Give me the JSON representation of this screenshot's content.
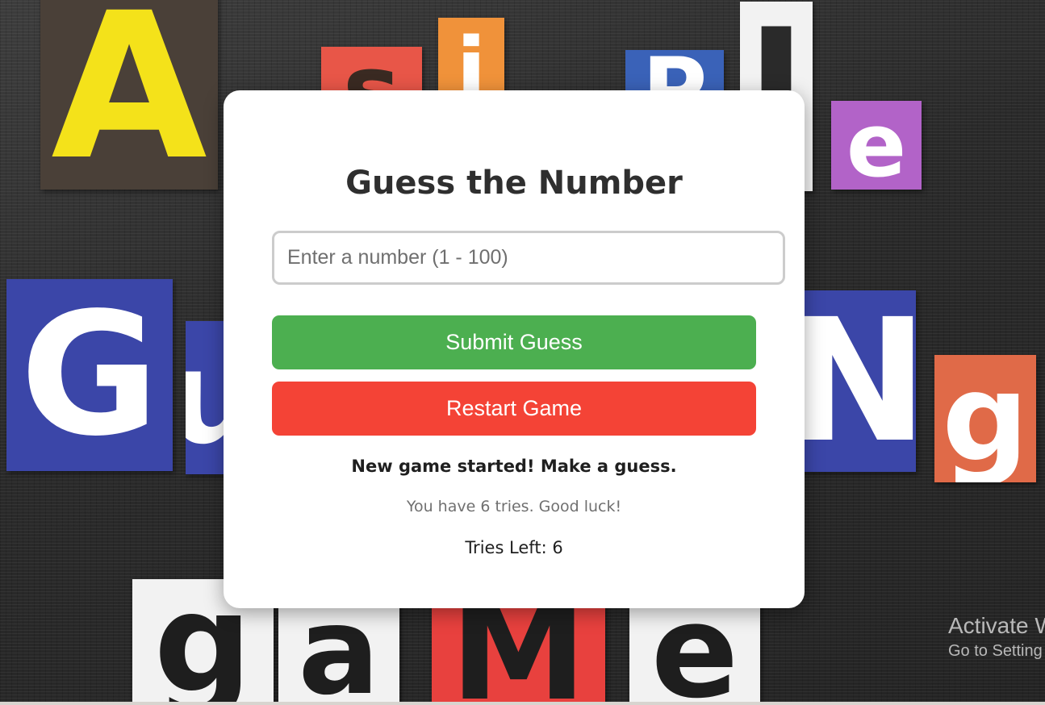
{
  "background": {
    "tiles": [
      {
        "letter": "A",
        "bg": "#4a4038",
        "fg": "#f4e21a"
      },
      {
        "letter": "s",
        "bg": "#e85648",
        "fg": "#3a2a22"
      },
      {
        "letter": "i",
        "bg": "#f0923a",
        "fg": "#ffffff"
      },
      {
        "letter": "P",
        "bg": "#3a62b8",
        "fg": "#ffffff"
      },
      {
        "letter": "l",
        "bg": "#f2f2f2",
        "fg": "#2a2a2a"
      },
      {
        "letter": "e",
        "bg": "#b263c8",
        "fg": "#ffffff"
      },
      {
        "letter": "G",
        "bg": "#3b46a8",
        "fg": "#ffffff"
      },
      {
        "letter": "u",
        "bg": "#3b46a8",
        "fg": "#ffffff"
      },
      {
        "letter": "N",
        "bg": "#3b46a8",
        "fg": "#ffffff"
      },
      {
        "letter": "g",
        "bg": "#e06a48",
        "fg": "#ffffff"
      },
      {
        "letter": "g",
        "bg": "#f2f2f2",
        "fg": "#1e1e1e"
      },
      {
        "letter": "a",
        "bg": "#f2f2f2",
        "fg": "#1e1e1e"
      },
      {
        "letter": "M",
        "bg": "#e8413e",
        "fg": "#1e1e1e"
      },
      {
        "letter": "e",
        "bg": "#f2f2f2",
        "fg": "#1e1e1e"
      }
    ]
  },
  "game": {
    "title": "Guess the Number",
    "input": {
      "placeholder": "Enter a number (1 - 100)",
      "value": ""
    },
    "submit_label": "Submit Guess",
    "restart_label": "Restart Game",
    "message": "New game started! Make a guess.",
    "hint": "You have 6 tries. Good luck!",
    "tries_text": "Tries Left: 6"
  },
  "colors": {
    "submit": "#4caf50",
    "restart": "#f44336"
  },
  "watermark": {
    "line1": "Activate W",
    "line2": "Go to Setting"
  }
}
